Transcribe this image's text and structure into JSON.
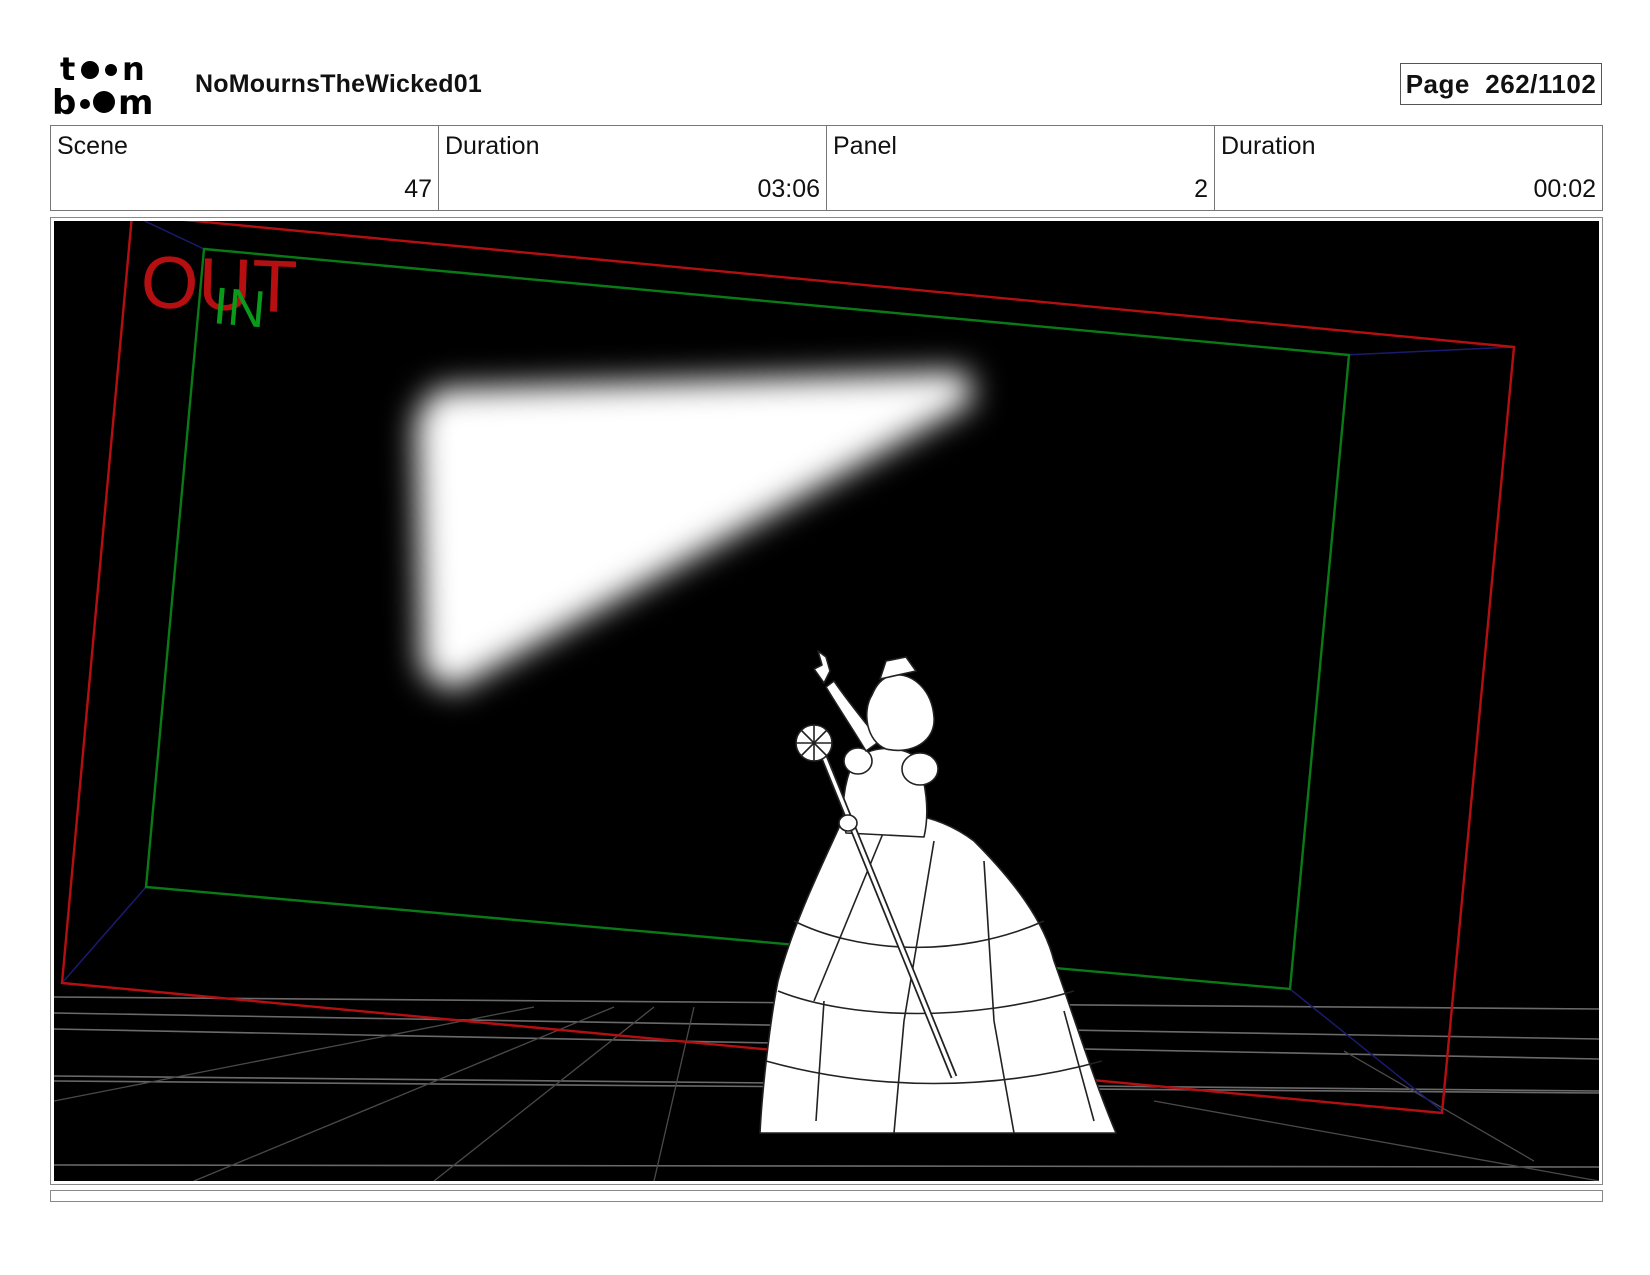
{
  "header": {
    "logo_text_top": "toon",
    "logo_text_bottom": "boom",
    "project_name": "NoMournsTheWicked01",
    "page_label": "Page  262/1102"
  },
  "info": {
    "scene_label": "Scene",
    "scene_value": "47",
    "scene_duration_label": "Duration",
    "scene_duration_value": "03:06",
    "panel_label": "Panel",
    "panel_value": "2",
    "panel_duration_label": "Duration",
    "panel_duration_value": "00:02"
  },
  "panel": {
    "out_label": "OUT",
    "in_label": "IN",
    "out_color": "#b50f12",
    "in_color": "#0a9a1a"
  }
}
